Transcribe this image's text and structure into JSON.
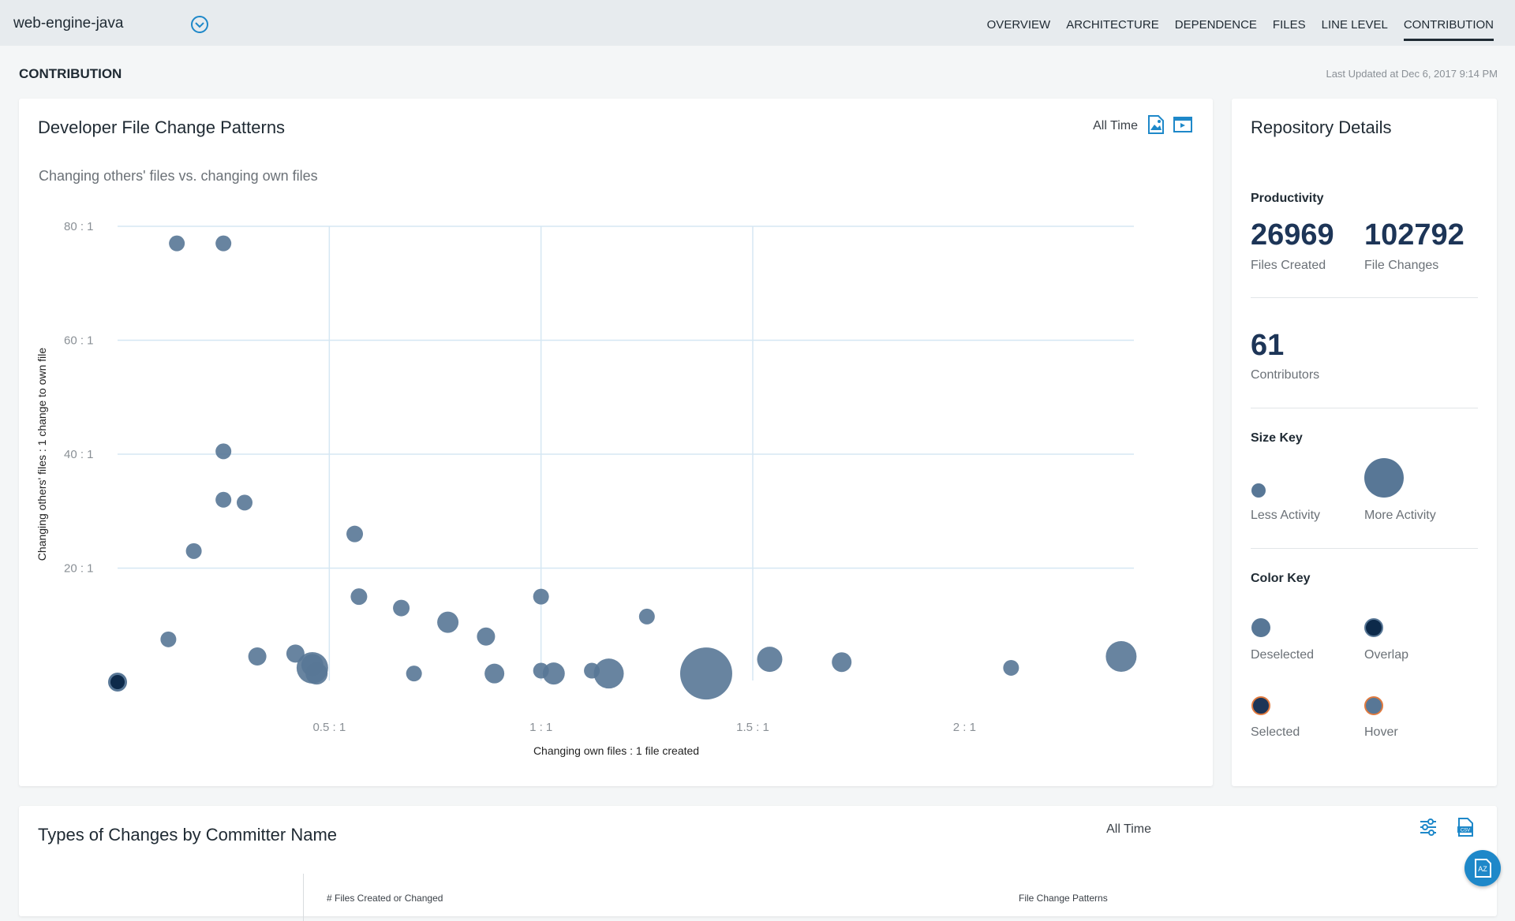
{
  "header": {
    "repo_name": "web-engine-java",
    "nav": [
      "OVERVIEW",
      "ARCHITECTURE",
      "DEPENDENCE",
      "FILES",
      "LINE LEVEL",
      "CONTRIBUTION"
    ],
    "active_nav": "CONTRIBUTION"
  },
  "page": {
    "title": "CONTRIBUTION",
    "last_updated": "Last Updated at Dec 6, 2017 9:14 PM"
  },
  "chart_card": {
    "title": "Developer File Change Patterns",
    "filter": "All Time",
    "icons": [
      "image-export-icon",
      "expand-icon"
    ]
  },
  "chart_data": {
    "type": "scatter",
    "title": "Changing others' files vs. changing own files",
    "xlabel": "Changing own files : 1 file created",
    "ylabel": "Changing others' files : 1 change to own file",
    "xlim": [
      0,
      2.4
    ],
    "ylim": [
      0,
      80
    ],
    "x_ticks": [
      0.5,
      1,
      1.5,
      2
    ],
    "x_tick_labels": [
      "0.5 : 1",
      "1 : 1",
      "1.5 : 1",
      "2 : 1"
    ],
    "y_ticks": [
      20,
      40,
      60,
      80
    ],
    "y_tick_labels": [
      "20 : 1",
      "40 : 1",
      "60 : 1",
      "80 : 1"
    ],
    "grid": true,
    "encoding": "bubble size = activity",
    "colors": {
      "deselected": "#587796",
      "overlap": "#0d2a4a",
      "selected_ring": "#e07a3f"
    },
    "points": [
      {
        "x": 0.14,
        "y": 77,
        "size": 1.0
      },
      {
        "x": 0.25,
        "y": 77,
        "size": 1.0
      },
      {
        "x": 0.25,
        "y": 40.5,
        "size": 1.0
      },
      {
        "x": 0.25,
        "y": 32,
        "size": 1.0
      },
      {
        "x": 0.3,
        "y": 31.5,
        "size": 1.0
      },
      {
        "x": 0.18,
        "y": 23,
        "size": 1.0
      },
      {
        "x": 0.56,
        "y": 26,
        "size": 1.05
      },
      {
        "x": 0.57,
        "y": 15,
        "size": 1.05
      },
      {
        "x": 0.67,
        "y": 13,
        "size": 1.05
      },
      {
        "x": 0.78,
        "y": 10.5,
        "size": 1.35
      },
      {
        "x": 0.87,
        "y": 8,
        "size": 1.15
      },
      {
        "x": 1.0,
        "y": 15,
        "size": 1.0
      },
      {
        "x": 1.25,
        "y": 11.5,
        "size": 1.0
      },
      {
        "x": 0.12,
        "y": 7.5,
        "size": 1.0
      },
      {
        "x": 0.33,
        "y": 4.5,
        "size": 1.15
      },
      {
        "x": 0.42,
        "y": 5,
        "size": 1.15
      },
      {
        "x": 0.46,
        "y": 2.5,
        "size": 2.0
      },
      {
        "x": 0.46,
        "y": 3,
        "size": 1.4
      },
      {
        "x": 0.47,
        "y": 1.5,
        "size": 1.4
      },
      {
        "x": 0.7,
        "y": 1.5,
        "size": 1.0
      },
      {
        "x": 0.89,
        "y": 1.5,
        "size": 1.25
      },
      {
        "x": 1.0,
        "y": 2,
        "size": 1.0
      },
      {
        "x": 1.03,
        "y": 1.5,
        "size": 1.4
      },
      {
        "x": 1.12,
        "y": 2,
        "size": 1.0
      },
      {
        "x": 1.16,
        "y": 1.5,
        "size": 1.9
      },
      {
        "x": 1.39,
        "y": 1.5,
        "size": 3.3
      },
      {
        "x": 1.54,
        "y": 4,
        "size": 1.6
      },
      {
        "x": 1.71,
        "y": 3.5,
        "size": 1.25
      },
      {
        "x": 2.11,
        "y": 2.5,
        "size": 1.0
      },
      {
        "x": 2.37,
        "y": 4.5,
        "size": 1.95
      },
      {
        "x": 0.0,
        "y": 0,
        "size": 1.0,
        "state": "overlap"
      }
    ]
  },
  "repo_details": {
    "title": "Repository Details",
    "productivity_label": "Productivity",
    "files_created": "26969",
    "files_created_label": "Files Created",
    "file_changes": "102792",
    "file_changes_label": "File Changes",
    "contributors": "61",
    "contributors_label": "Contributors",
    "size_key_label": "Size Key",
    "less_activity": "Less Activity",
    "more_activity": "More Activity",
    "color_key_label": "Color Key",
    "deselected": "Deselected",
    "overlap": "Overlap",
    "selected": "Selected",
    "hover": "Hover"
  },
  "bottom_card": {
    "title": "Types of Changes by Committer Name",
    "filter": "All Time",
    "icons": [
      "filter-sliders-icon",
      "csv-export-icon"
    ],
    "col_files": "# Files Created or Changed",
    "col_patterns": "File Change Patterns"
  },
  "fab": {
    "label": "AZ"
  }
}
